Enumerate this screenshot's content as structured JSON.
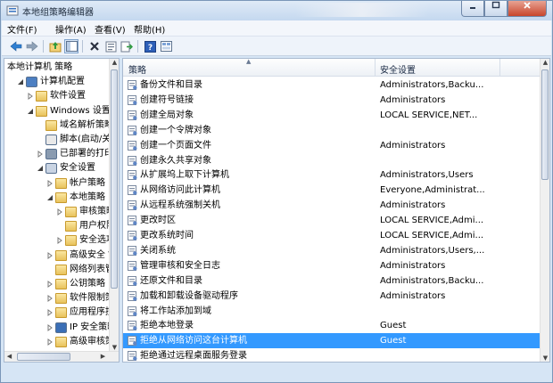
{
  "window": {
    "title": "本地组策略编辑器"
  },
  "menubar": [
    {
      "label": "文件(F)"
    },
    {
      "label": "操作(A)"
    },
    {
      "label": "查看(V)"
    },
    {
      "label": "帮助(H)"
    }
  ],
  "toolbar": {
    "buttons": [
      {
        "icon": "back-arrow-icon"
      },
      {
        "icon": "forward-arrow-icon"
      },
      {
        "icon": "up-folder-icon"
      },
      {
        "icon": "show-hide-tree-icon"
      },
      {
        "icon": "delete-icon"
      },
      {
        "icon": "properties-icon"
      },
      {
        "icon": "export-list-icon"
      },
      {
        "icon": "help-icon"
      },
      {
        "icon": "view-icon"
      }
    ]
  },
  "tree": [
    {
      "label": "本地计算机 策略",
      "level": 0,
      "expander": "none",
      "icon": "computer-policy-icon"
    },
    {
      "label": "计算机配置",
      "level": 1,
      "expander": "open",
      "icon": "computer-icon"
    },
    {
      "label": "软件设置",
      "level": 2,
      "expander": "closed",
      "icon": "folder-icon"
    },
    {
      "label": "Windows 设置",
      "level": 2,
      "expander": "open",
      "icon": "folder-icon"
    },
    {
      "label": "域名解析策略",
      "level": 3,
      "expander": "none",
      "icon": "folder-icon"
    },
    {
      "label": "脚本(启动/关机",
      "level": 3,
      "expander": "none",
      "icon": "script-icon"
    },
    {
      "label": "已部署的打印机",
      "level": 3,
      "expander": "closed",
      "icon": "printer-icon"
    },
    {
      "label": "安全设置",
      "level": 3,
      "expander": "open",
      "icon": "security-icon"
    },
    {
      "label": "帐户策略",
      "level": 4,
      "expander": "closed",
      "icon": "folder-icon"
    },
    {
      "label": "本地策略",
      "level": 4,
      "expander": "open",
      "icon": "folder-icon"
    },
    {
      "label": "审核策略",
      "level": 5,
      "expander": "closed",
      "icon": "folder-icon"
    },
    {
      "label": "用户权限",
      "level": 5,
      "expander": "none",
      "icon": "folder-icon"
    },
    {
      "label": "安全选项",
      "level": 5,
      "expander": "closed",
      "icon": "folder-icon"
    },
    {
      "label": "高级安全 W",
      "level": 4,
      "expander": "closed",
      "icon": "folder-icon"
    },
    {
      "label": "网络列表管",
      "level": 4,
      "expander": "none",
      "icon": "folder-icon"
    },
    {
      "label": "公钥策略",
      "level": 4,
      "expander": "closed",
      "icon": "folder-icon"
    },
    {
      "label": "软件限制策",
      "level": 4,
      "expander": "closed",
      "icon": "folder-icon"
    },
    {
      "label": "应用程序控",
      "level": 4,
      "expander": "closed",
      "icon": "folder-icon"
    },
    {
      "label": "IP 安全策略",
      "level": 4,
      "expander": "closed",
      "icon": "ip-security-icon"
    },
    {
      "label": "高级审核策",
      "level": 4,
      "expander": "closed",
      "icon": "folder-icon"
    }
  ],
  "list": {
    "columns": {
      "policy": "策略",
      "setting": "安全设置"
    },
    "rows": [
      {
        "name": "备份文件和目录",
        "value": "Administrators,Backu...",
        "selected": false
      },
      {
        "name": "创建符号链接",
        "value": "Administrators",
        "selected": false
      },
      {
        "name": "创建全局对象",
        "value": "LOCAL SERVICE,NET...",
        "selected": false
      },
      {
        "name": "创建一个令牌对象",
        "value": "",
        "selected": false
      },
      {
        "name": "创建一个页面文件",
        "value": "Administrators",
        "selected": false
      },
      {
        "name": "创建永久共享对象",
        "value": "",
        "selected": false
      },
      {
        "name": "从扩展坞上取下计算机",
        "value": "Administrators,Users",
        "selected": false
      },
      {
        "name": "从网络访问此计算机",
        "value": "Everyone,Administrat...",
        "selected": false
      },
      {
        "name": "从远程系统强制关机",
        "value": "Administrators",
        "selected": false
      },
      {
        "name": "更改时区",
        "value": "LOCAL SERVICE,Admi...",
        "selected": false
      },
      {
        "name": "更改系统时间",
        "value": "LOCAL SERVICE,Admi...",
        "selected": false
      },
      {
        "name": "关闭系统",
        "value": "Administrators,Users,...",
        "selected": false
      },
      {
        "name": "管理审核和安全日志",
        "value": "Administrators",
        "selected": false
      },
      {
        "name": "还原文件和目录",
        "value": "Administrators,Backu...",
        "selected": false
      },
      {
        "name": "加载和卸载设备驱动程序",
        "value": "Administrators",
        "selected": false
      },
      {
        "name": "将工作站添加到域",
        "value": "",
        "selected": false
      },
      {
        "name": "拒绝本地登录",
        "value": "Guest",
        "selected": false
      },
      {
        "name": "拒绝从网络访问这台计算机",
        "value": "Guest",
        "selected": true
      },
      {
        "name": "拒绝通过远程桌面服务登录",
        "value": "",
        "selected": false
      }
    ]
  },
  "colors": {
    "selection": "#3399ff",
    "chrome": "#d6e5f5"
  }
}
